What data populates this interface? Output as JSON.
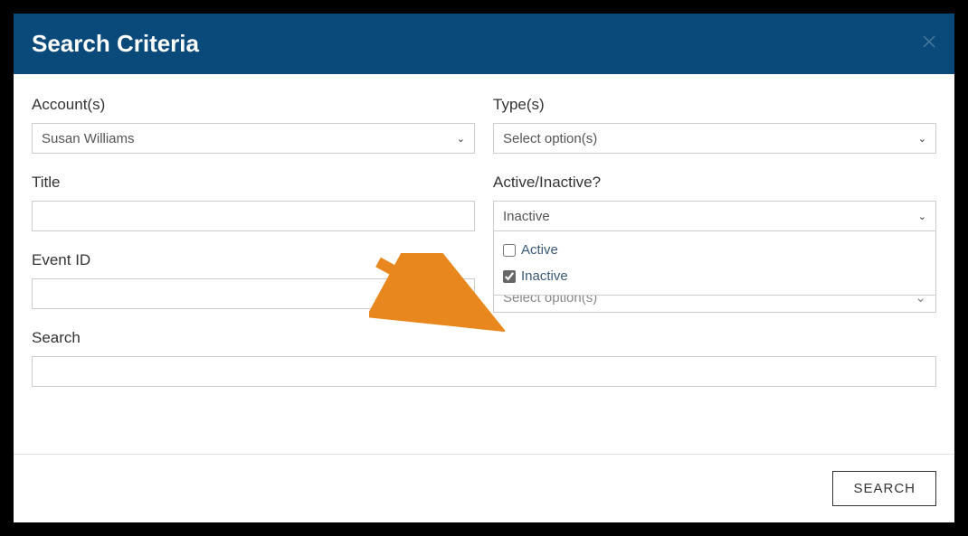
{
  "header": {
    "title": "Search Criteria"
  },
  "form": {
    "accounts": {
      "label": "Account(s)",
      "value": "Susan Williams"
    },
    "types": {
      "label": "Type(s)",
      "placeholder": "Select option(s)"
    },
    "title": {
      "label": "Title",
      "value": ""
    },
    "active_inactive": {
      "label": "Active/Inactive?",
      "value": "Inactive",
      "options": [
        {
          "label": "Active",
          "checked": false
        },
        {
          "label": "Inactive",
          "checked": true
        }
      ]
    },
    "event_id": {
      "label": "Event ID",
      "value": ""
    },
    "behind_select": {
      "placeholder": "Select option(s)"
    },
    "search": {
      "label": "Search",
      "value": ""
    }
  },
  "footer": {
    "search_button": "SEARCH"
  }
}
